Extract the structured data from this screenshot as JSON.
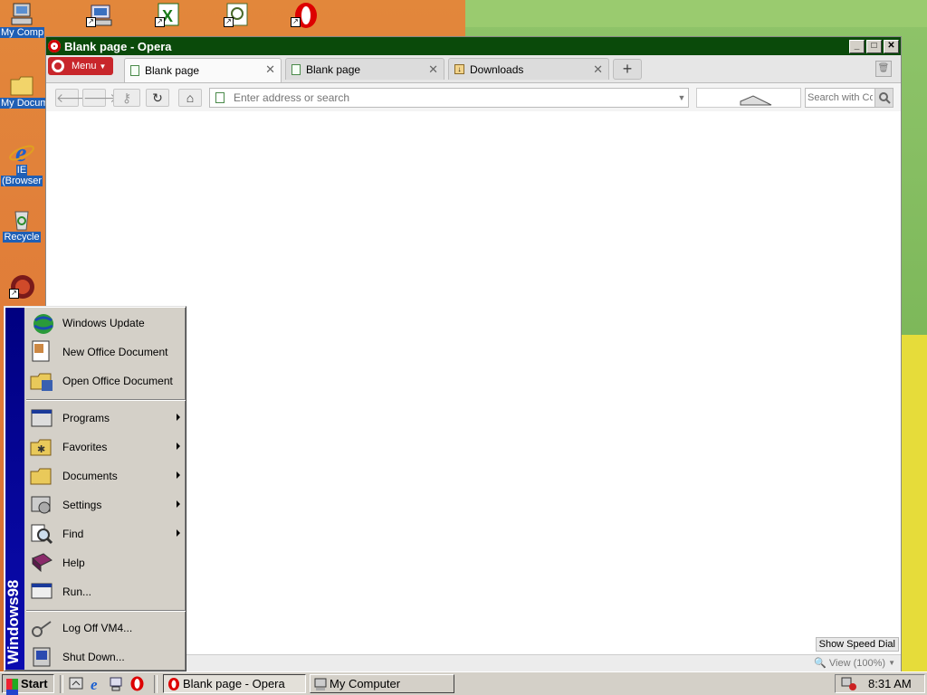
{
  "desktop": {
    "icons": [
      {
        "label": "My Comp"
      },
      {
        "label": "My Docum"
      },
      {
        "label": "IE"
      },
      {
        "label": "(Browser"
      },
      {
        "label": "Recycle"
      }
    ]
  },
  "browser": {
    "title": "Blank page - Opera",
    "menu_label": "Menu",
    "tabs": [
      {
        "label": "Blank page"
      },
      {
        "label": "Blank page"
      },
      {
        "label": "Downloads"
      }
    ],
    "address_placeholder": "Enter address or search",
    "search_placeholder": "Search with Co",
    "speed_dial_button": "Show Speed Dial",
    "zoom_label": "View (100%)"
  },
  "start_menu": {
    "banner": "Windows98",
    "top_items": [
      {
        "label": "Windows Update"
      },
      {
        "label": "New Office Document"
      },
      {
        "label": "Open Office Document"
      }
    ],
    "items": [
      {
        "label": "Programs"
      },
      {
        "label": "Favorites"
      },
      {
        "label": "Documents"
      },
      {
        "label": "Settings"
      },
      {
        "label": "Find"
      },
      {
        "label": "Help"
      },
      {
        "label": "Run..."
      }
    ],
    "bottom_items": [
      {
        "label": "Log Off VM4..."
      },
      {
        "label": "Shut Down..."
      }
    ]
  },
  "taskbar": {
    "start_label": "Start",
    "tasks": [
      {
        "label": "Blank page - Opera"
      },
      {
        "label": "My Computer"
      }
    ],
    "clock": "8:31 AM"
  }
}
